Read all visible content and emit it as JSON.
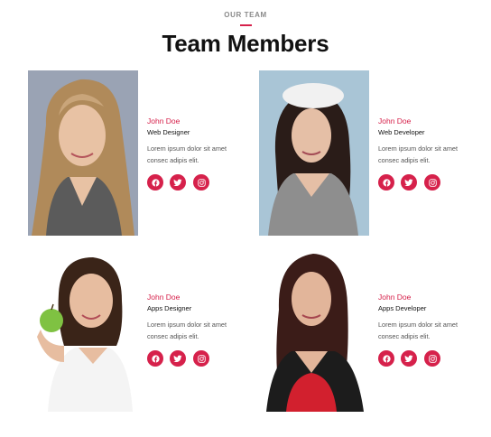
{
  "header": {
    "eyebrow": "OUR TEAM",
    "title": "Team Members"
  },
  "accent_color": "#d6214b",
  "members": [
    {
      "name": "John Doe",
      "role": "Web Designer",
      "bio": "Lorem ipsum dolor sit amet consec adipis elit.",
      "socials": [
        "facebook-icon",
        "twitter-icon",
        "instagram-icon"
      ]
    },
    {
      "name": "John Doe",
      "role": "Web Developer",
      "bio": "Lorem ipsum dolor sit amet consec adipis elit.",
      "socials": [
        "facebook-icon",
        "twitter-icon",
        "instagram-icon"
      ]
    },
    {
      "name": "John Doe",
      "role": "Apps Designer",
      "bio": "Lorem ipsum dolor sit amet consec adipis elit.",
      "socials": [
        "facebook-icon",
        "twitter-icon",
        "instagram-icon"
      ]
    },
    {
      "name": "John Doe",
      "role": "Apps Developer",
      "bio": "Lorem ipsum dolor sit amet consec adipis elit.",
      "socials": [
        "facebook-icon",
        "twitter-icon",
        "instagram-icon"
      ]
    }
  ]
}
